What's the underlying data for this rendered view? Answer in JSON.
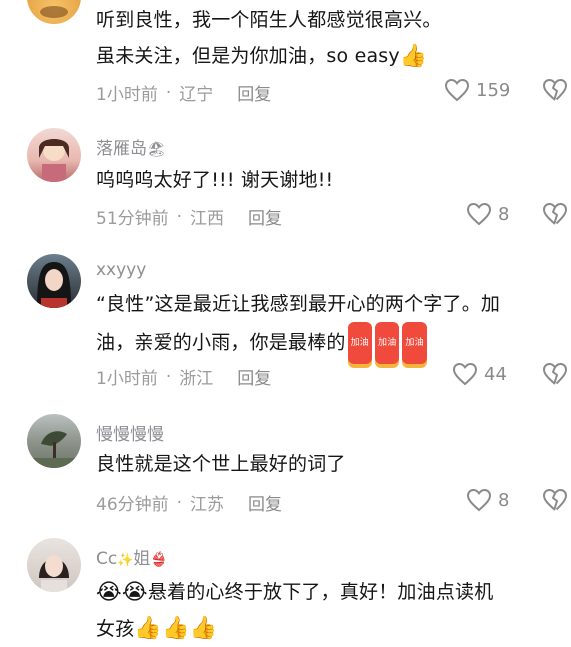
{
  "comments": [
    {
      "username": "",
      "line1": "听到良性，我一个陌生人都感觉很高兴。",
      "line2": "虽未关注，但是为你加油，so easy",
      "time": "1小时前",
      "location": "辽宁",
      "reply": "回复",
      "likes": "159"
    },
    {
      "username": "落雁岛",
      "line1": "呜呜呜太好了!!! 谢天谢地!!",
      "time": "51分钟前",
      "location": "江西",
      "reply": "回复",
      "likes": "8"
    },
    {
      "username": "xxyyy",
      "line1": "“良性”这是最近让我感到最开心的两个字了。加",
      "line2": "油，亲爱的小雨，你是最棒的",
      "sticker": "加油",
      "time": "1小时前",
      "location": "浙江",
      "reply": "回复",
      "likes": "44"
    },
    {
      "username": "慢慢慢慢",
      "line1": "良性就是这个世上最好的词了",
      "time": "46分钟前",
      "location": "江苏",
      "reply": "回复",
      "likes": "8"
    },
    {
      "username": "Cc",
      "username_suffix": "姐",
      "line1": "悬着的心终于放下了，真好！加油点读机",
      "line2": "女孩",
      "time": "",
      "location": "",
      "reply": "",
      "likes": ""
    }
  ],
  "separator": "·",
  "icons": {
    "like": "heart-outline-icon",
    "dislike": "broken-heart-icon",
    "thumbs": "thumbs-up-emoji",
    "crying": "crying-emoji"
  },
  "colors": {
    "text": "#161616",
    "meta": "#9b9b9b",
    "icon": "#8a8a8a"
  }
}
